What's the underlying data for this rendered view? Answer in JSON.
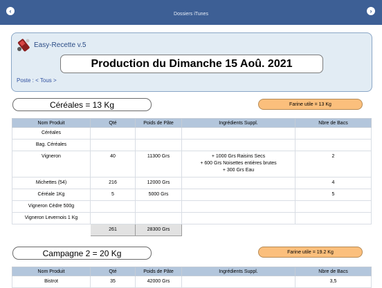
{
  "nav": {
    "title": "Dossiers iTunes"
  },
  "app": {
    "name": "Easy-Recette v.5"
  },
  "production_title": "Production du Dimanche 15 Aoû. 2021",
  "poste": "Poste : < Tous >",
  "columns": [
    "Nom Produit",
    "Qté",
    "Poids de Pâte",
    "Ingrédients Suppl.",
    "Nbre de Bacs"
  ],
  "sections": [
    {
      "name": "Céréales = 13 Kg",
      "farine": "Farine utile = 13 Kg",
      "rows": [
        {
          "name": "Céréales",
          "qte": "",
          "poids": "",
          "ingredients": [],
          "bacs": ""
        },
        {
          "name": "Bag. Céréales",
          "qte": "",
          "poids": "",
          "ingredients": [],
          "bacs": ""
        },
        {
          "name": "Vigneron",
          "qte": "40",
          "poids": "11300 Grs",
          "ingredients": [
            "+ 1000 Grs Raisins Secs",
            "+ 600 Grs Noisettes entières brutes",
            "+ 300 Grs Eau"
          ],
          "bacs": "2"
        },
        {
          "name": "Michettes (54)",
          "qte": "216",
          "poids": "12000 Grs",
          "ingredients": [],
          "bacs": "4"
        },
        {
          "name": "Céréale 1Kg",
          "qte": "5",
          "poids": "5000 Grs",
          "ingredients": [],
          "bacs": "5"
        },
        {
          "name": "Vigneron Cèdre 500g",
          "qte": "",
          "poids": "",
          "ingredients": [],
          "bacs": ""
        },
        {
          "name": "Vigneron Levernois 1 Kg",
          "qte": "",
          "poids": "",
          "ingredients": [],
          "bacs": ""
        }
      ],
      "totals": {
        "qte": "261",
        "poids": "28300 Grs"
      }
    },
    {
      "name": "Campagne 2 = 20 Kg",
      "farine": "Farine utile = 19.2 Kg",
      "rows": [
        {
          "name": "Bistrot",
          "qte": "35",
          "poids": "42000 Grs",
          "ingredients": [],
          "bacs": "3,5"
        }
      ]
    }
  ]
}
